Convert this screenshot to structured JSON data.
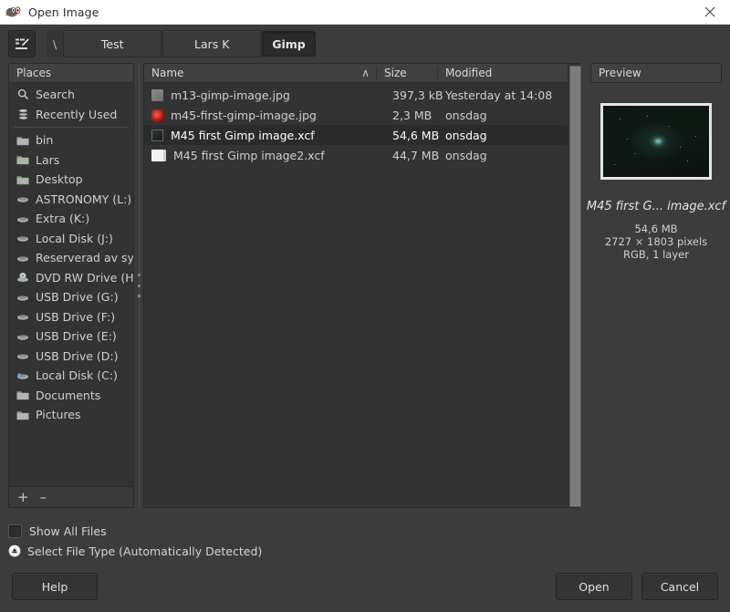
{
  "window": {
    "title": "Open Image",
    "icon": "gimp-wilber-icon",
    "close_label": "✕"
  },
  "pathbar": {
    "location_button_icon": "type-file-name-icon",
    "crumbs": [
      {
        "label": "\\",
        "type": "separator",
        "active": false
      },
      {
        "label": "Test",
        "type": "button",
        "active": false
      },
      {
        "label": "Lars K",
        "type": "button",
        "active": false
      },
      {
        "label": "Gimp",
        "type": "button",
        "active": true
      }
    ]
  },
  "places": {
    "header": "Places",
    "items": [
      {
        "label": "Search",
        "icon": "search-icon"
      },
      {
        "label": "Recently Used",
        "icon": "recent-icon"
      },
      {
        "label": "bin",
        "icon": "folder-icon"
      },
      {
        "label": "Lars",
        "icon": "folder-icon"
      },
      {
        "label": "Desktop",
        "icon": "folder-icon"
      },
      {
        "label": "ASTRONOMY (L:)",
        "icon": "drive-icon"
      },
      {
        "label": "Extra (K:)",
        "icon": "drive-icon"
      },
      {
        "label": "Local Disk (J:)",
        "icon": "drive-icon"
      },
      {
        "label": "Reserverad av sy...",
        "icon": "drive-icon"
      },
      {
        "label": "DVD RW Drive (H:)",
        "icon": "optical-drive-icon"
      },
      {
        "label": "USB Drive (G:)",
        "icon": "drive-icon"
      },
      {
        "label": "USB Drive (F:)",
        "icon": "drive-icon"
      },
      {
        "label": "USB Drive (E:)",
        "icon": "drive-icon"
      },
      {
        "label": "USB Drive (D:)",
        "icon": "drive-icon"
      },
      {
        "label": "Local Disk (C:)",
        "icon": "system-drive-icon"
      },
      {
        "label": "Documents",
        "icon": "folder-icon"
      },
      {
        "label": "Pictures",
        "icon": "folder-icon"
      }
    ],
    "footer": {
      "add_label": "+",
      "remove_label": "–"
    }
  },
  "filelist": {
    "columns": {
      "name": "Name",
      "size": "Size",
      "modified": "Modified"
    },
    "sort": {
      "column": "Name",
      "direction": "ascending",
      "arrow": "∧"
    },
    "rows": [
      {
        "name": "m13-gimp-image.jpg",
        "size": "397,3 kB",
        "modified": "Yesterday at 14:08",
        "thumb": "t-grey",
        "selected": false
      },
      {
        "name": "m45-first-gimp-image.jpg",
        "size": "2,3 MB",
        "modified": "onsdag",
        "thumb": "t-red",
        "selected": false
      },
      {
        "name": "M45 first Gimp image.xcf",
        "size": "54,6 MB",
        "modified": "onsdag",
        "thumb": "t-dark",
        "selected": true
      },
      {
        "name": "M45 first Gimp image2.xcf",
        "size": "44,7 MB",
        "modified": "onsdag",
        "thumb": "t-white",
        "selected": false
      }
    ]
  },
  "preview": {
    "header": "Preview",
    "filename": "M45 first G... image.xcf",
    "filesize": "54,6 MB",
    "dimensions": "2727 × 1803 pixels",
    "colorinfo": "RGB, 1 layer"
  },
  "options": {
    "show_all_files": {
      "label": "Show All Files",
      "checked": false
    },
    "select_file_type": {
      "label": "Select File Type (Automatically Detected)",
      "expanded": false
    }
  },
  "actions": {
    "help": "Help",
    "open": "Open",
    "cancel": "Cancel"
  },
  "colors": {
    "window_bg": "#3c3c3c",
    "pane_bg": "#333333",
    "header_bg": "#414141",
    "selection_bg": "#2b2b2b",
    "text": "#d3d3d3",
    "titlebar_bg": "#ffffff"
  }
}
